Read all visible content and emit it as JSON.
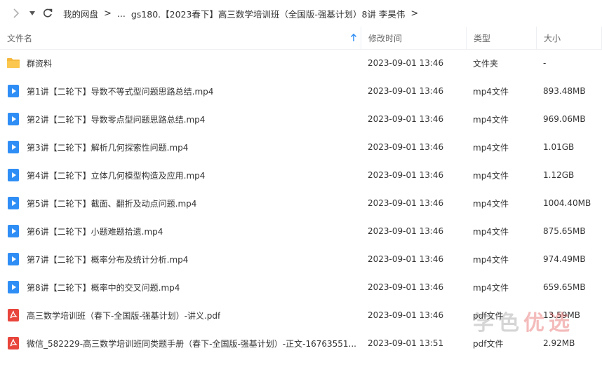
{
  "breadcrumb": {
    "root": "我的网盘",
    "ellipsis": "...",
    "folder": "gs180.【2023春下】高三数学培训班（全国版-强基计划）8讲 李昊伟"
  },
  "columns": {
    "name": "文件名",
    "modified": "修改时间",
    "type": "类型",
    "size": "大小"
  },
  "files": [
    {
      "name": "群资料",
      "modified": "2023-09-01 13:46",
      "type": "文件夹",
      "size": "-",
      "icon": "folder-icon"
    },
    {
      "name": "第1讲【二轮下】导数不等式型问题思路总结.mp4",
      "modified": "2023-09-01 13:46",
      "type": "mp4文件",
      "size": "893.48MB",
      "icon": "video-icon"
    },
    {
      "name": "第2讲【二轮下】导数零点型问题思路总结.mp4",
      "modified": "2023-09-01 13:46",
      "type": "mp4文件",
      "size": "969.06MB",
      "icon": "video-icon"
    },
    {
      "name": "第3讲【二轮下】解析几何探索性问题.mp4",
      "modified": "2023-09-01 13:46",
      "type": "mp4文件",
      "size": "1.01GB",
      "icon": "video-icon"
    },
    {
      "name": "第4讲【二轮下】立体几何模型构造及应用.mp4",
      "modified": "2023-09-01 13:46",
      "type": "mp4文件",
      "size": "1.12GB",
      "icon": "video-icon"
    },
    {
      "name": "第5讲【二轮下】截面、翻折及动点问题.mp4",
      "modified": "2023-09-01 13:46",
      "type": "mp4文件",
      "size": "1004.40MB",
      "icon": "video-icon"
    },
    {
      "name": "第6讲【二轮下】小题难题拾遗.mp4",
      "modified": "2023-09-01 13:46",
      "type": "mp4文件",
      "size": "875.65MB",
      "icon": "video-icon"
    },
    {
      "name": "第7讲【二轮下】概率分布及统计分析.mp4",
      "modified": "2023-09-01 13:46",
      "type": "mp4文件",
      "size": "974.49MB",
      "icon": "video-icon"
    },
    {
      "name": "第8讲【二轮下】概率中的交叉问题.mp4",
      "modified": "2023-09-01 13:46",
      "type": "mp4文件",
      "size": "659.65MB",
      "icon": "video-icon"
    },
    {
      "name": "高三数学培训班（春下-全国版-强基计划）-讲义.pdf",
      "modified": "2023-09-01 13:46",
      "type": "pdf文件",
      "size": "13.59MB",
      "icon": "pdf-icon"
    },
    {
      "name": "微信_582229-高三数学培训班同类题手册（春下-全国版-强基计划）-正文-16763551...",
      "modified": "2023-09-01 13:51",
      "type": "pdf文件",
      "size": "2.92MB",
      "icon": "pdf-icon"
    }
  ],
  "watermark": {
    "part1": "学色",
    "part2": "优选"
  },
  "colors": {
    "folder": "#f5b83d",
    "video": "#2f8ef5",
    "pdf": "#e8453c"
  }
}
